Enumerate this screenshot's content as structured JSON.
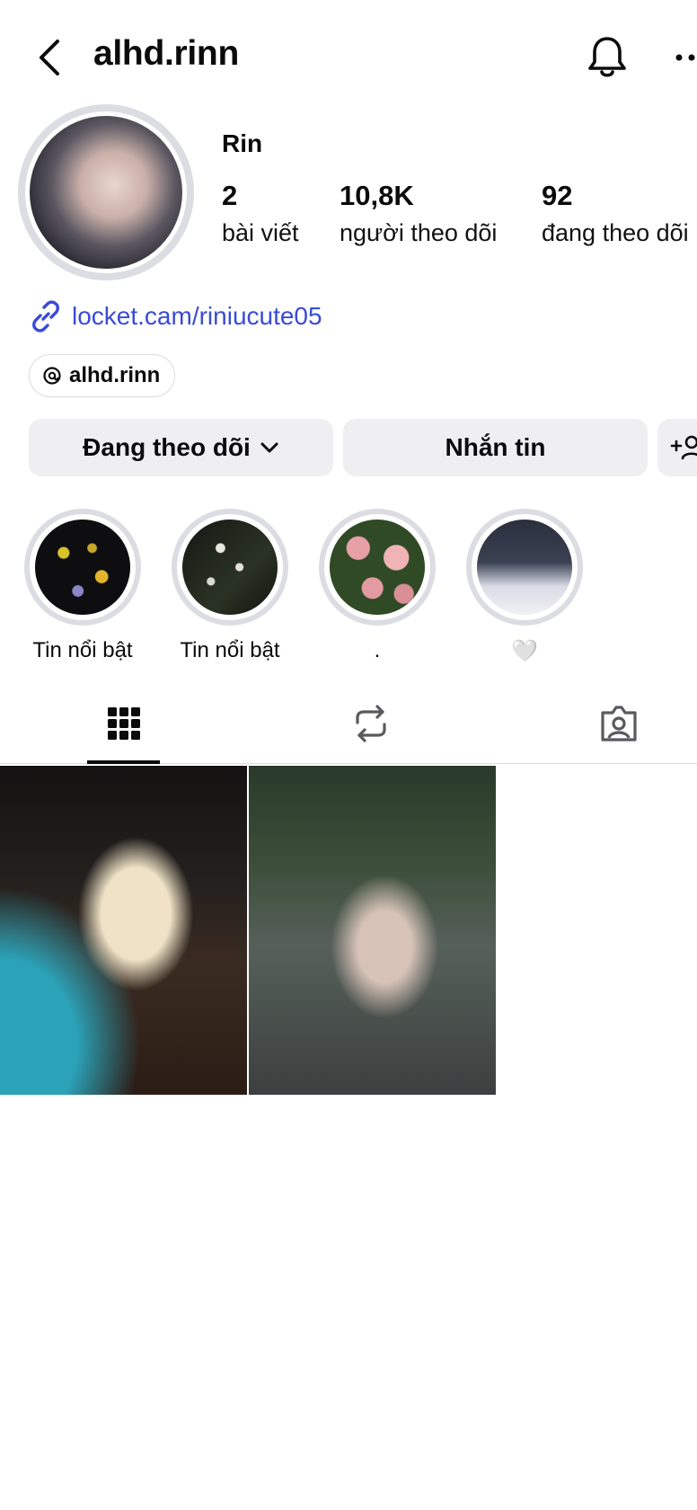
{
  "header": {
    "username": "alhd.rinn",
    "back_icon": "chevron-left-icon",
    "bell_icon": "bell-icon",
    "more_icon": "more-horizontal-icon"
  },
  "profile": {
    "display_name": "Rin",
    "stats": [
      {
        "value": "2",
        "label": "bài viết"
      },
      {
        "value": "10,8K",
        "label": "người theo dõi"
      },
      {
        "value": "92",
        "label": "đang theo dõi"
      }
    ],
    "link": "locket.cam/riniucute05",
    "threads_handle": "alhd.rinn"
  },
  "actions": {
    "following_label": "Đang theo dõi",
    "message_label": "Nhắn tin"
  },
  "highlights": [
    {
      "label": "Tin nổi bật"
    },
    {
      "label": "Tin nổi bật"
    },
    {
      "label": "."
    },
    {
      "label": "🤍"
    }
  ],
  "tabs": [
    {
      "icon": "grid-icon",
      "active": true
    },
    {
      "icon": "repost-icon",
      "active": false
    },
    {
      "icon": "tagged-icon",
      "active": false
    }
  ],
  "colors": {
    "link": "#3a4bd6",
    "button_bg": "#efeff2",
    "ring": "#dcdde2"
  }
}
